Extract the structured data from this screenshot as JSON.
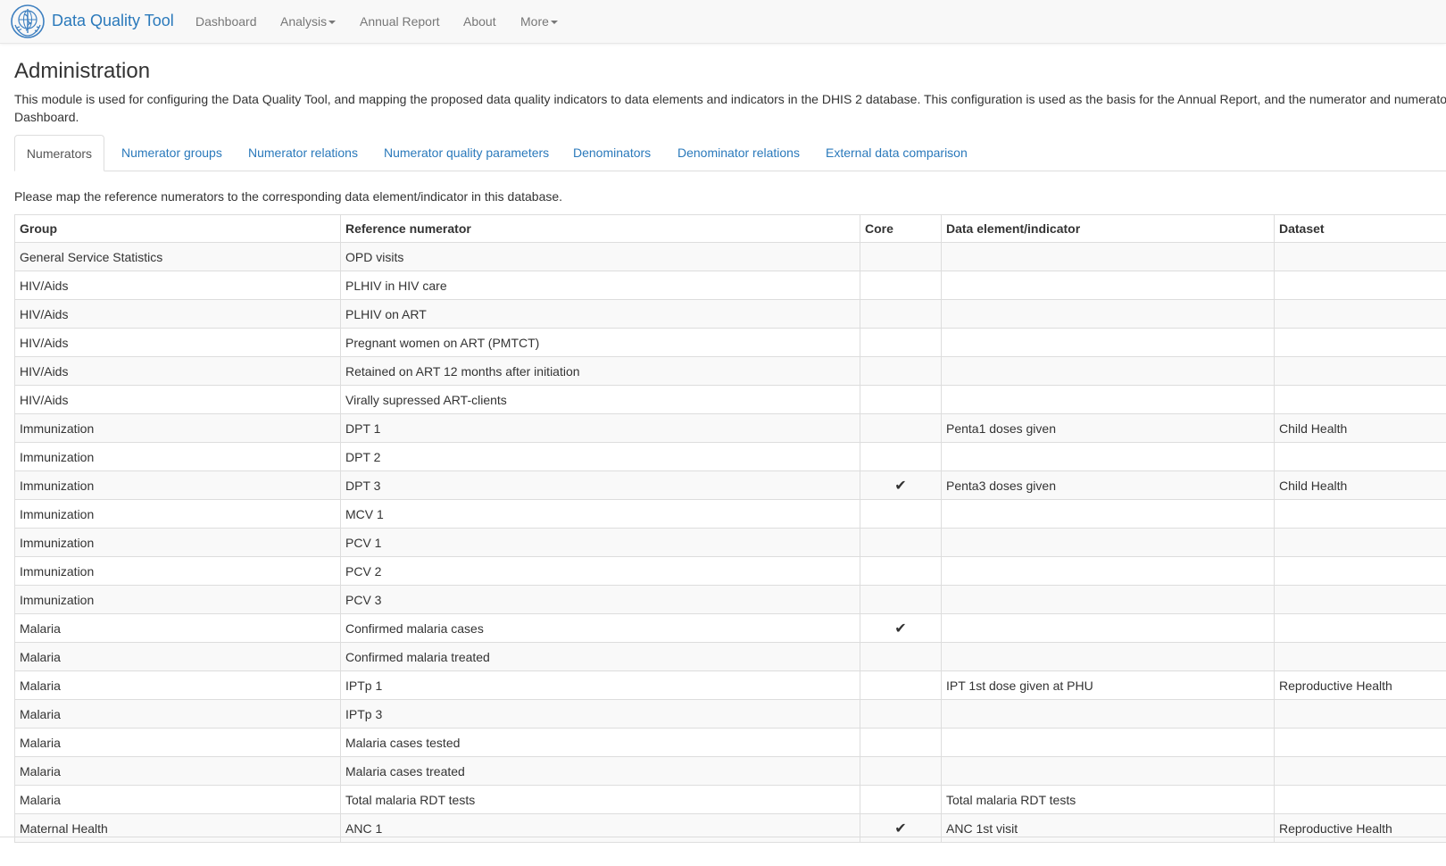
{
  "navbar": {
    "brand": "Data Quality Tool",
    "logo_icon": "who-emblem-icon",
    "items": [
      {
        "label": "Dashboard"
      },
      {
        "label": "Analysis",
        "dropdown": true
      },
      {
        "label": "Annual Report"
      },
      {
        "label": "About"
      },
      {
        "label": "More",
        "dropdown": true
      }
    ]
  },
  "page": {
    "title": "Administration",
    "intro": "This module is used for configuring the Data Quality Tool, and mapping the proposed data quality indicators to data elements and indicators in the DHIS 2 database. This configuration is used as the basis for the Annual Report, and the numerator and numerator Dashboard.",
    "instructions": "Please map the reference numerators to the corresponding data element/indicator in this database."
  },
  "tabs": [
    {
      "label": "Numerators",
      "active": true
    },
    {
      "label": "Numerator groups"
    },
    {
      "label": "Numerator relations"
    },
    {
      "label": "Numerator quality parameters"
    },
    {
      "label": "Denominators"
    },
    {
      "label": "Denominator relations"
    },
    {
      "label": "External data comparison"
    }
  ],
  "table": {
    "headers": [
      "Group",
      "Reference numerator",
      "Core",
      "Data element/indicator",
      "Dataset"
    ],
    "rows": [
      {
        "group": "General Service Statistics",
        "numerator": "OPD visits",
        "core": "",
        "data_element": "",
        "dataset": ""
      },
      {
        "group": "HIV/Aids",
        "numerator": "PLHIV in HIV care",
        "core": "",
        "data_element": "",
        "dataset": ""
      },
      {
        "group": "HIV/Aids",
        "numerator": "PLHIV on ART",
        "core": "",
        "data_element": "",
        "dataset": ""
      },
      {
        "group": "HIV/Aids",
        "numerator": "Pregnant women on ART (PMTCT)",
        "core": "",
        "data_element": "",
        "dataset": ""
      },
      {
        "group": "HIV/Aids",
        "numerator": "Retained on ART 12 months after initiation",
        "core": "",
        "data_element": "",
        "dataset": ""
      },
      {
        "group": "HIV/Aids",
        "numerator": "Virally supressed ART-clients",
        "core": "",
        "data_element": "",
        "dataset": ""
      },
      {
        "group": "Immunization",
        "numerator": "DPT 1",
        "core": "",
        "data_element": "Penta1 doses given",
        "dataset": "Child Health"
      },
      {
        "group": "Immunization",
        "numerator": "DPT 2",
        "core": "",
        "data_element": "",
        "dataset": ""
      },
      {
        "group": "Immunization",
        "numerator": "DPT 3",
        "core": "✔",
        "data_element": "Penta3 doses given",
        "dataset": "Child Health"
      },
      {
        "group": "Immunization",
        "numerator": "MCV 1",
        "core": "",
        "data_element": "",
        "dataset": ""
      },
      {
        "group": "Immunization",
        "numerator": "PCV 1",
        "core": "",
        "data_element": "",
        "dataset": ""
      },
      {
        "group": "Immunization",
        "numerator": "PCV 2",
        "core": "",
        "data_element": "",
        "dataset": ""
      },
      {
        "group": "Immunization",
        "numerator": "PCV 3",
        "core": "",
        "data_element": "",
        "dataset": ""
      },
      {
        "group": "Malaria",
        "numerator": "Confirmed malaria cases",
        "core": "✔",
        "data_element": "",
        "dataset": ""
      },
      {
        "group": "Malaria",
        "numerator": "Confirmed malaria treated",
        "core": "",
        "data_element": "",
        "dataset": ""
      },
      {
        "group": "Malaria",
        "numerator": "IPTp 1",
        "core": "",
        "data_element": "IPT 1st dose given at PHU",
        "dataset": "Reproductive Health"
      },
      {
        "group": "Malaria",
        "numerator": "IPTp 3",
        "core": "",
        "data_element": "",
        "dataset": ""
      },
      {
        "group": "Malaria",
        "numerator": "Malaria cases tested",
        "core": "",
        "data_element": "",
        "dataset": ""
      },
      {
        "group": "Malaria",
        "numerator": "Malaria cases treated",
        "core": "",
        "data_element": "",
        "dataset": ""
      },
      {
        "group": "Malaria",
        "numerator": "Total malaria RDT tests",
        "core": "",
        "data_element": "Total malaria RDT tests",
        "dataset": ""
      },
      {
        "group": "Maternal Health",
        "numerator": "ANC 1",
        "core": "✔",
        "data_element": "ANC 1st visit",
        "dataset": "Reproductive Health"
      }
    ]
  },
  "colors": {
    "accent": "#2a79bb",
    "navbar_bg": "#f8f8f8",
    "border": "#dddddd",
    "stripe": "#f9f9f9"
  }
}
